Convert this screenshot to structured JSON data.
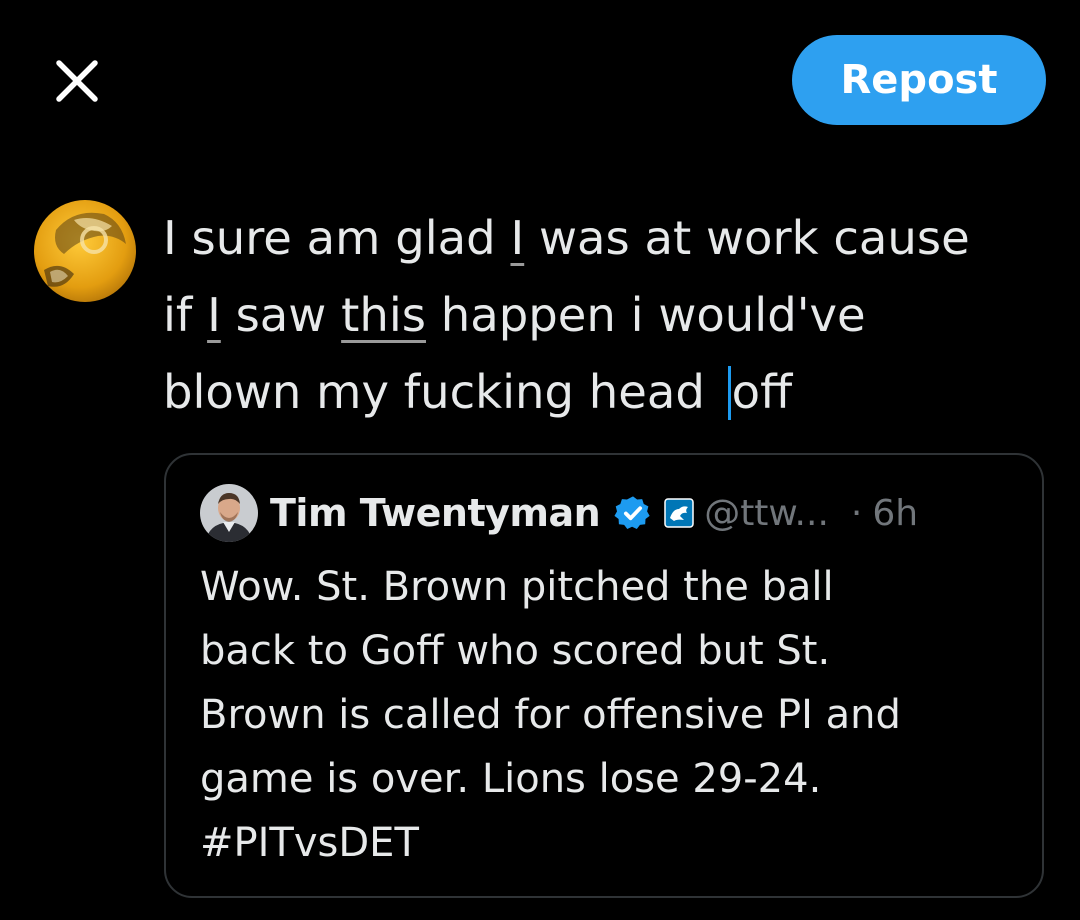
{
  "header": {
    "close_icon": "close-icon",
    "repost_label": "Repost"
  },
  "colors": {
    "background": "#000000",
    "accent": "#1d9bf0",
    "repost_button": "#2ea0f0",
    "text": "#e7e9ea",
    "muted": "#71767b",
    "border": "#2f3336",
    "avatar_gold": "#f2b21b"
  },
  "composer": {
    "avatar_icon": "user-avatar-icon",
    "lines": [
      {
        "a": "I sure am glad ",
        "b": "I",
        "c": " was at work cause"
      },
      {
        "a": "if ",
        "b": "I",
        "c": " saw ",
        "d": "this",
        "e": " happen i would've"
      },
      {
        "a": "blown my fucking head ",
        "b": "off"
      }
    ]
  },
  "quote": {
    "name": "Tim Twentyman",
    "handle": "@ttw...",
    "separator": "·",
    "time": "6h",
    "verified_icon": "verified-badge-icon",
    "affiliation_icon": "lions-affiliation-icon",
    "lines": [
      "Wow. St. Brown pitched the ball",
      "back to Goff who scored but St.",
      "Brown is called for offensive PI and",
      "game is over. Lions lose 29-24.",
      "#PITvsDET"
    ]
  }
}
